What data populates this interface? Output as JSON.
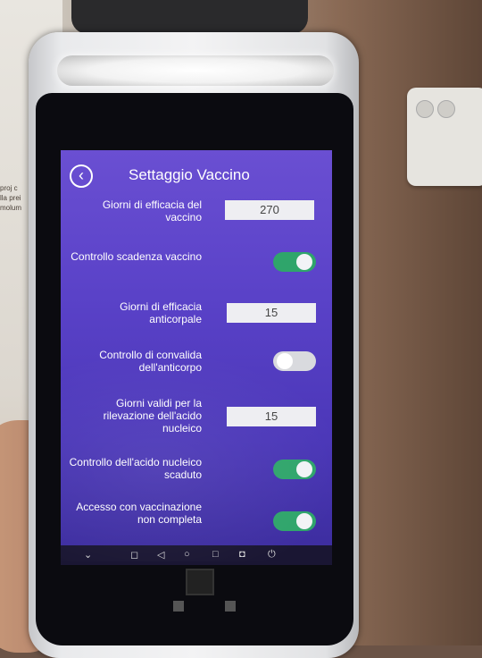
{
  "wall_note": "proj c\nlla prei\nmolum",
  "app": {
    "title": "Settaggio Vaccino",
    "back_icon": "back-arrow-icon"
  },
  "settings": [
    {
      "label": "Giorni di efficacia del vaccino",
      "type": "field",
      "value": "270"
    },
    {
      "label": "Controllo scadenza vaccino",
      "type": "toggle",
      "state": "on"
    },
    {
      "label": "Giorni di efficacia anticorpale",
      "type": "field",
      "value": "15"
    },
    {
      "label": "Controllo di convalida dell'anticorpo",
      "type": "toggle",
      "state": "off"
    },
    {
      "label": "Giorni validi per la rilevazione dell'acido nucleico",
      "type": "field",
      "value": "15"
    },
    {
      "label": "Controllo dell'acido nucleico scaduto",
      "type": "toggle",
      "state": "on"
    },
    {
      "label": "Accesso con vaccinazione non completa",
      "type": "toggle",
      "state": "on"
    }
  ],
  "nav": {
    "collapse": "⌄",
    "vol_down": "◻",
    "back": "◁",
    "home": "○",
    "recent": "□",
    "vol_up": "◘",
    "power": "⏻"
  },
  "colors": {
    "screen_bg": "#5a42c8",
    "toggle_on": "#2fa56b",
    "toggle_off": "#d9dade"
  }
}
